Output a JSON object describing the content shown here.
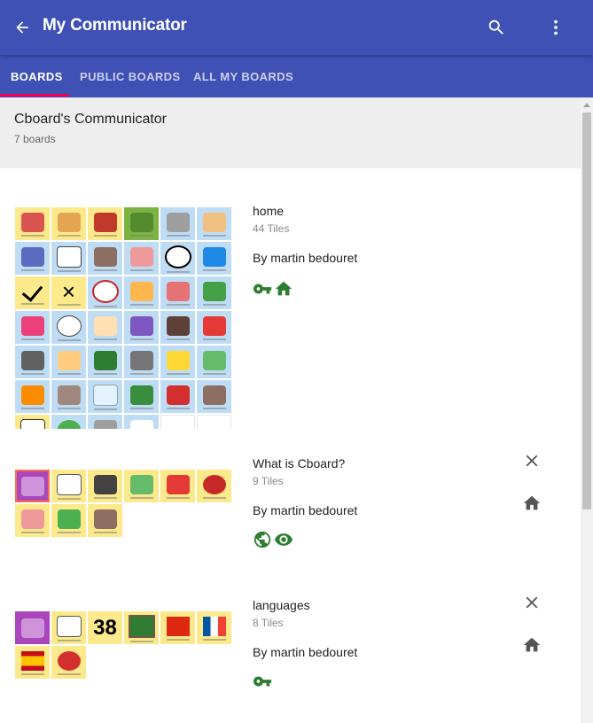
{
  "app": {
    "title": "My Communicator"
  },
  "tabs": [
    {
      "label": "BOARDS",
      "active": true
    },
    {
      "label": "PUBLIC BOARDS",
      "active": false
    },
    {
      "label": "ALL MY BOARDS",
      "active": false
    }
  ],
  "communicator": {
    "name": "Cboard's Communicator",
    "board_count": "7 boards"
  },
  "colors": {
    "primary": "#3f51b5",
    "accent": "#f50057",
    "badge_green": "#2e7d32"
  },
  "boards": [
    {
      "name": "home",
      "tiles": "44 Tiles",
      "author": "By martin bedouret",
      "badges": [
        "key-icon",
        "home-icon"
      ],
      "actions": []
    },
    {
      "name": "What is Cboard?",
      "tiles": "9 Tiles",
      "author": "By martin bedouret",
      "badges": [
        "public-icon",
        "visibility-icon"
      ],
      "actions": [
        "close-icon",
        "home-icon"
      ]
    },
    {
      "name": "languages",
      "tiles": "8 Tiles",
      "author": "By martin bedouret",
      "badges": [
        "key-icon"
      ],
      "actions": [
        "close-icon",
        "home-icon"
      ],
      "thumbnail_text": "38"
    }
  ]
}
